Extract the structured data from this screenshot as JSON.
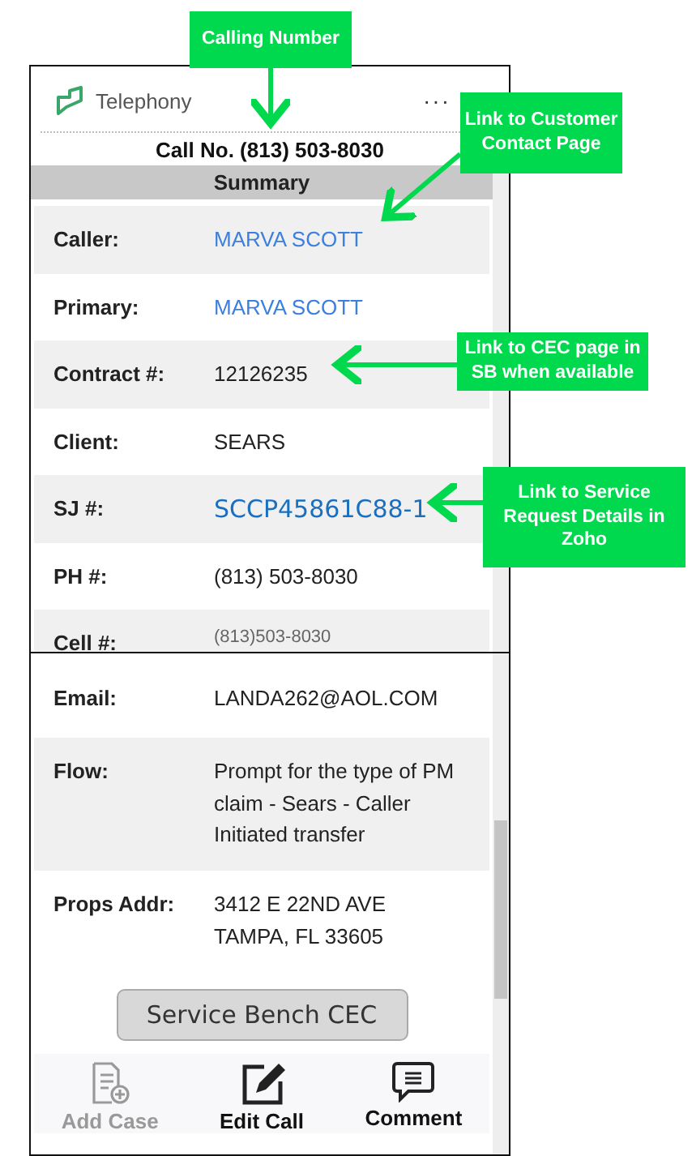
{
  "header": {
    "app_name": "Telephony",
    "more": "···"
  },
  "call_number": "Call No. (813) 503-8030",
  "section_title": "Summary",
  "top_fields": [
    {
      "label": "Caller:",
      "value": "MARVA SCOTT",
      "kind": "link"
    },
    {
      "label": "Primary:",
      "value": "MARVA SCOTT",
      "kind": "link"
    },
    {
      "label": "Contract #:",
      "value": "12126235",
      "kind": "text"
    },
    {
      "label": "Client:",
      "value": "SEARS",
      "kind": "text"
    },
    {
      "label": "SJ #:",
      "value": "SCCP45861C88-1",
      "kind": "ref_link"
    },
    {
      "label": "PH #:",
      "value": "(813) 503-8030",
      "kind": "text"
    },
    {
      "label": "Cell #:",
      "value": "(813)503-8030",
      "kind": "faint"
    }
  ],
  "bottom_fields": [
    {
      "label": "Email:",
      "value": "LANDA262@AOL.COM"
    },
    {
      "label": "Flow:",
      "value": "Prompt for the type of PM claim - Sears - Caller Initiated transfer"
    },
    {
      "label": "Props Addr:",
      "value": "3412 E 22ND AVE\nTAMPA, FL 33605"
    }
  ],
  "button": "Service Bench CEC",
  "actions": [
    {
      "label": "Add Case",
      "kind": "add",
      "disabled": true
    },
    {
      "label": "Edit Call",
      "kind": "edit",
      "disabled": false
    },
    {
      "label": "Comment",
      "kind": "comment",
      "disabled": false
    }
  ],
  "annotations": [
    {
      "text": "Calling Number"
    },
    {
      "text": "Link to Customer Contact Page"
    },
    {
      "text": "Link to CEC page in SB when available"
    },
    {
      "text": "Link to Service Request Details in Zoho"
    }
  ]
}
